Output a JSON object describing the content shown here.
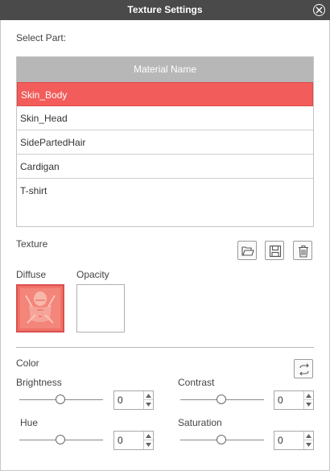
{
  "window": {
    "title": "Texture Settings"
  },
  "select_part": {
    "label": "Select Part:",
    "column_header": "Material Name",
    "rows": [
      "Skin_Body",
      "Skin_Head",
      "SidePartedHair",
      "Cardigan",
      "T-shirt"
    ],
    "selected": "Skin_Body"
  },
  "texture": {
    "label": "Texture",
    "diffuse_label": "Diffuse",
    "opacity_label": "Opacity"
  },
  "color": {
    "label": "Color",
    "brightness": {
      "label": "Brightness",
      "value": "0"
    },
    "contrast": {
      "label": "Contrast",
      "value": "0"
    },
    "hue": {
      "label": "Hue",
      "value": "0"
    },
    "saturation": {
      "label": "Saturation",
      "value": "0"
    }
  },
  "colors": {
    "selected_row": "#f25c5a",
    "titlebar": "#4a4a4a",
    "header": "#b7b7b7"
  },
  "icons": [
    "close-icon",
    "open-folder-icon",
    "save-icon",
    "trash-icon",
    "reset-color-icon",
    "spin-up-icon",
    "spin-down-icon"
  ]
}
